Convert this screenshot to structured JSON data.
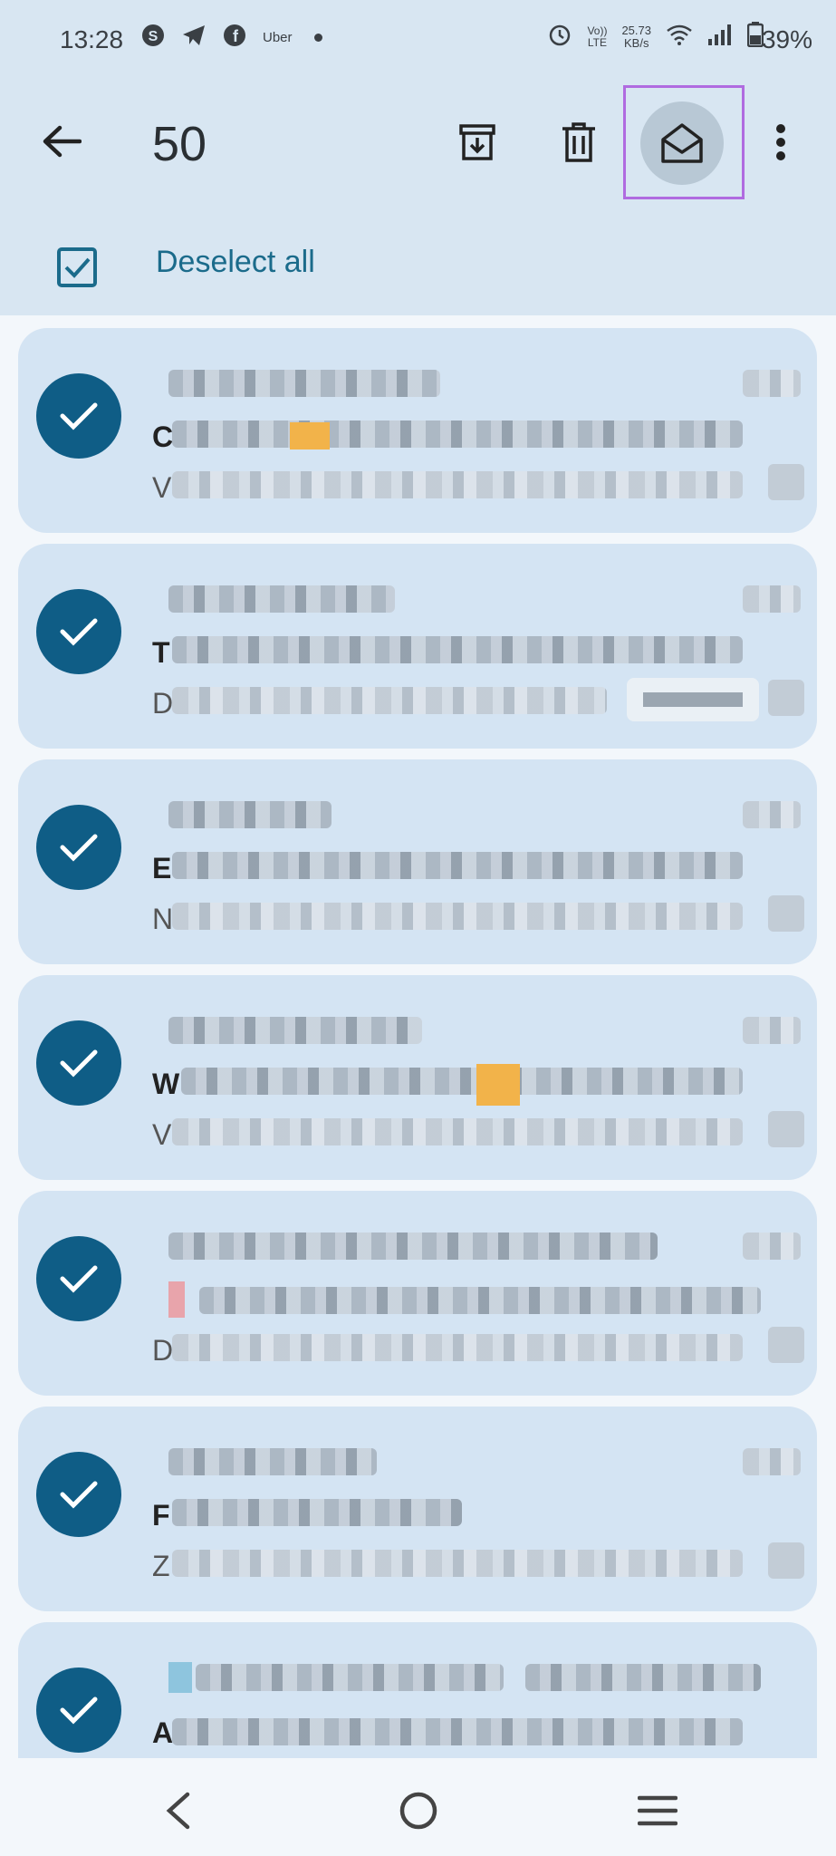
{
  "status_bar": {
    "time": "13:28",
    "left_icons": [
      "skype-icon",
      "telegram-icon",
      "facebook-icon"
    ],
    "uber_label": "Uber",
    "network_label_1": "Vo))",
    "network_label_2": "LTE",
    "speed_value": "25.73",
    "speed_unit": "KB/s",
    "battery": "39%"
  },
  "toolbar": {
    "selected_count": "50",
    "actions": [
      "archive-icon",
      "delete-icon",
      "mark-read-icon",
      "more-options-icon"
    ]
  },
  "selection": {
    "deselect_label": "Deselect all"
  },
  "emails": [
    {
      "subject_initial": "C",
      "preview_initial": "V"
    },
    {
      "subject_initial": "T",
      "preview_initial": "D"
    },
    {
      "subject_initial": "E",
      "preview_initial": "N"
    },
    {
      "subject_initial": "W",
      "preview_initial": "V"
    },
    {
      "subject_initial": "",
      "preview_initial": "D"
    },
    {
      "subject_initial": "F",
      "preview_initial": "Z"
    },
    {
      "subject_initial": "A",
      "preview_initial": ""
    }
  ],
  "colors": {
    "header_bg": "#d8e6f2",
    "item_bg": "#d4e4f3",
    "accent": "#0f5d86",
    "link": "#1b6b8b",
    "highlight": "#b06be0"
  }
}
